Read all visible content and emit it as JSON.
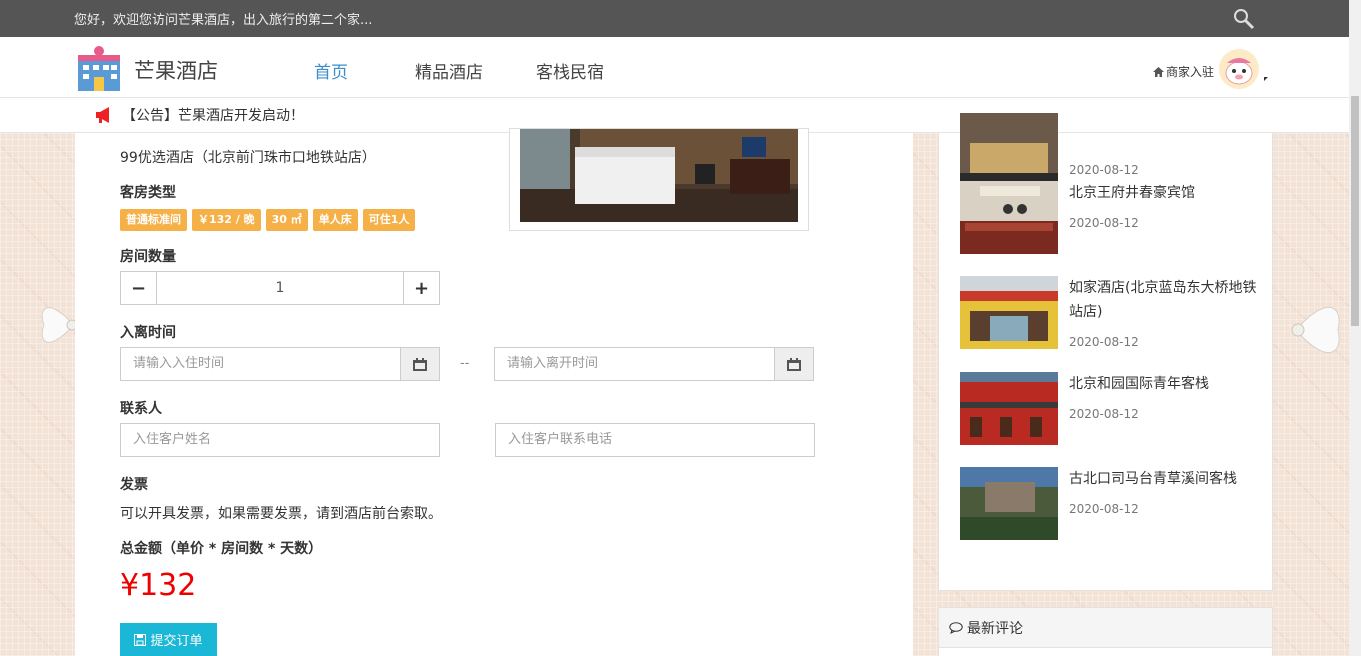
{
  "topbar": {
    "welcome": "您好，欢迎您访问芒果酒店，出入旅行的第二个家..."
  },
  "navbar": {
    "brand": "芒果酒店",
    "items": [
      {
        "label": "首页",
        "active": true
      },
      {
        "label": "精品酒店",
        "active": false
      },
      {
        "label": "客栈民宿",
        "active": false
      }
    ],
    "merchant": "商家入驻"
  },
  "notice": {
    "text": "【公告】芒果酒店开发启动！"
  },
  "order": {
    "hotel_name": "99优选酒店（北京前门珠市口地铁站店）",
    "room_type_label": "客房类型",
    "tags": [
      "普通标准间",
      "￥132 / 晚",
      "30 ㎡",
      "单人床",
      "可住1人"
    ],
    "room_count_label": "房间数量",
    "room_count": "1",
    "checkin_label": "入离时间",
    "checkin_placeholder": "请输入入住时间",
    "date_separator": "--",
    "checkout_placeholder": "请输入离开时间",
    "contact_label": "联系人",
    "contact_name_placeholder": "入住客户姓名",
    "contact_phone_placeholder": "入住客户联系电话",
    "invoice_label": "发票",
    "invoice_text": "可以开具发票，如果需要发票，请到酒店前台索取。",
    "total_label": "总金额（单价 * 房间数 * 天数）",
    "total": "¥132",
    "submit": "提交订单"
  },
  "sidebar": {
    "hotels": [
      {
        "name": "",
        "date": "2020-08-12"
      },
      {
        "name": "北京王府井春豪宾馆",
        "date": "2020-08-12"
      },
      {
        "name": "如家酒店(北京蓝岛东大桥地铁站店)",
        "date": "2020-08-12"
      },
      {
        "name": "北京和园国际青年客栈",
        "date": "2020-08-12"
      },
      {
        "name": "古北口司马台青草溪间客栈",
        "date": "2020-08-12"
      }
    ],
    "comments_title": "最新评论"
  },
  "colors": {
    "accent": "#3c8dcc",
    "tag": "#f6b048",
    "price": "#e00000",
    "submit": "#1ab8d6"
  }
}
